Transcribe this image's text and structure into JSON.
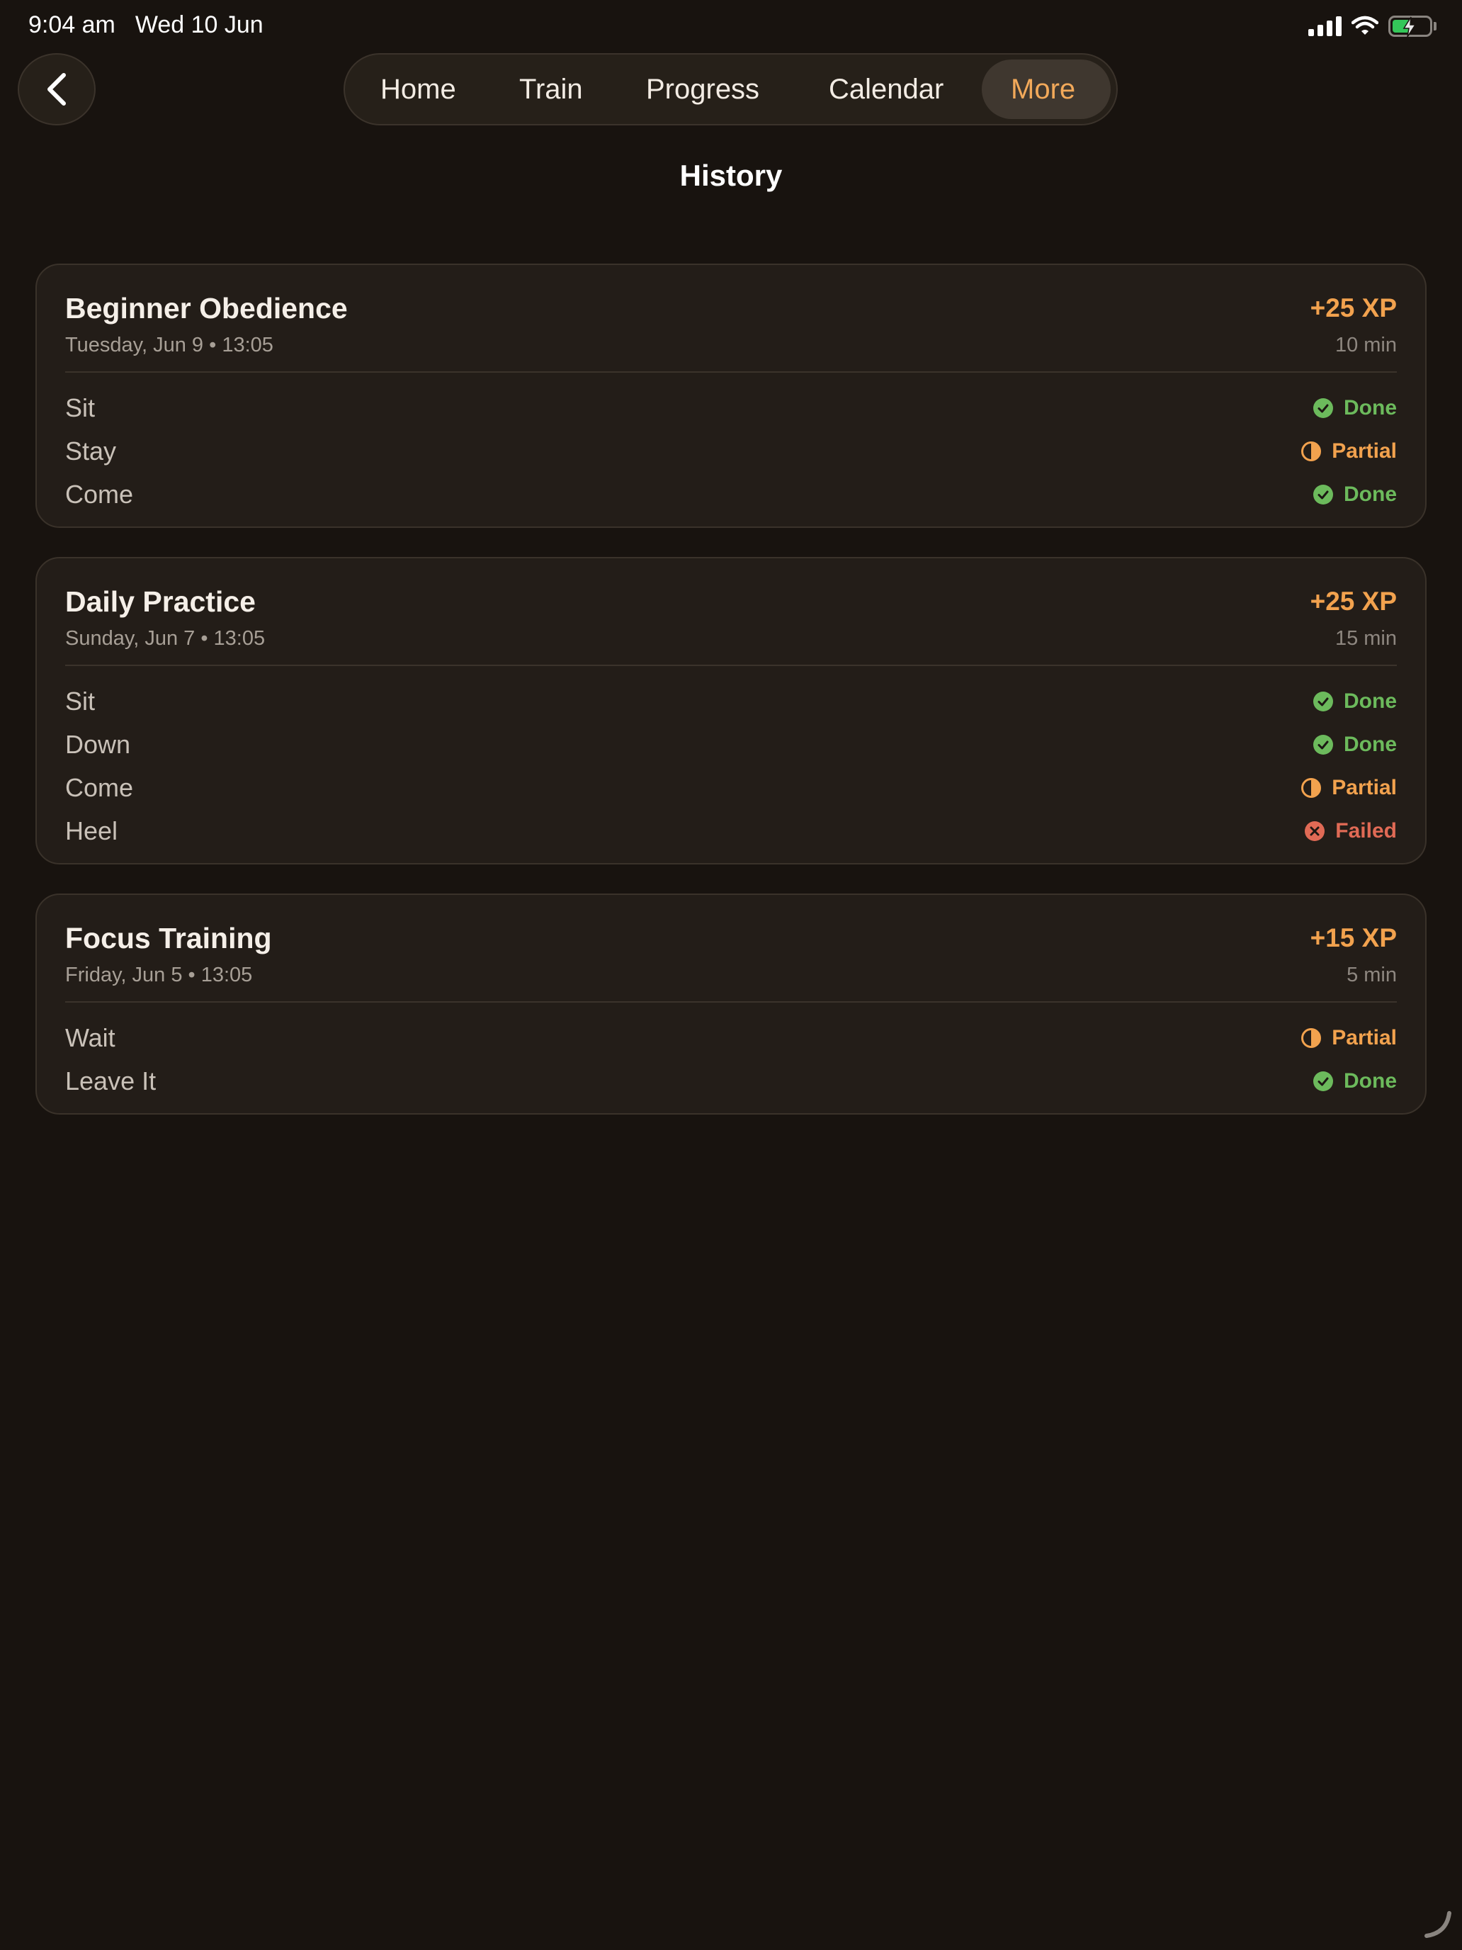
{
  "status_bar": {
    "time": "9:04 am",
    "date": "Wed 10 Jun"
  },
  "nav": {
    "back_icon": "chevron-left-icon",
    "tabs": [
      {
        "label": "Home",
        "active": false
      },
      {
        "label": "Train",
        "active": false
      },
      {
        "label": "Progress",
        "active": false
      },
      {
        "label": "Calendar",
        "active": false
      },
      {
        "label": "More",
        "active": true
      }
    ]
  },
  "page": {
    "title": "History"
  },
  "colors": {
    "done": "#6cba5c",
    "partial": "#f2a24e",
    "failed": "#e06a55",
    "accent": "#f2a95a"
  },
  "sessions": [
    {
      "title": "Beginner Obedience",
      "subtitle": "Tuesday, Jun 9 • 13:05",
      "xp": "+25 XP",
      "duration": "10 min",
      "exercises": [
        {
          "name": "Sit",
          "status": "Done"
        },
        {
          "name": "Stay",
          "status": "Partial"
        },
        {
          "name": "Come",
          "status": "Done"
        }
      ]
    },
    {
      "title": "Daily Practice",
      "subtitle": "Sunday, Jun 7 • 13:05",
      "xp": "+25 XP",
      "duration": "15 min",
      "exercises": [
        {
          "name": "Sit",
          "status": "Done"
        },
        {
          "name": "Down",
          "status": "Done"
        },
        {
          "name": "Come",
          "status": "Partial"
        },
        {
          "name": "Heel",
          "status": "Failed"
        }
      ]
    },
    {
      "title": "Focus Training",
      "subtitle": "Friday, Jun 5 • 13:05",
      "xp": "+15 XP",
      "duration": "5 min",
      "exercises": [
        {
          "name": "Wait",
          "status": "Partial"
        },
        {
          "name": "Leave It",
          "status": "Done"
        }
      ]
    }
  ]
}
